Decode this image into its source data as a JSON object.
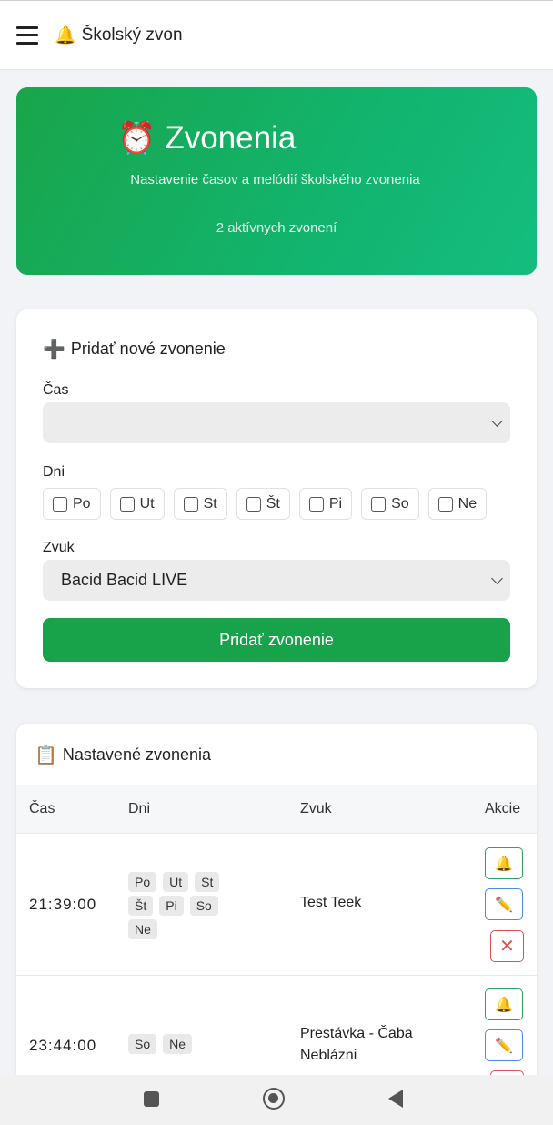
{
  "app": {
    "title": "Školský zvon",
    "bell_icon": "🔔"
  },
  "hero": {
    "icon": "⏰",
    "title": "Zvonenia",
    "subtitle": "Nastavenie časov a melódií školského zvonenia",
    "active_count": "2 aktívnych zvonení"
  },
  "form": {
    "icon": "➕",
    "title": "Pridať nové zvonenie",
    "time_label": "Čas",
    "time_value": "",
    "days_label": "Dni",
    "days": [
      "Po",
      "Ut",
      "St",
      "Št",
      "Pi",
      "So",
      "Ne"
    ],
    "sound_label": "Zvuk",
    "sound_value": "Bacid Bacid LIVE",
    "submit_label": "Pridať zvonenie",
    "accent_color": "#18a34b"
  },
  "list": {
    "icon": "📋",
    "title": "Nastavené zvonenia",
    "columns": {
      "time": "Čas",
      "days": "Dni",
      "sound": "Zvuk",
      "actions": "Akcie"
    },
    "rows": [
      {
        "time": "21:39:00",
        "days": [
          "Po",
          "Ut",
          "St",
          "Št",
          "Pi",
          "So",
          "Ne"
        ],
        "sound": "Test Teek"
      },
      {
        "time": "23:44:00",
        "days": [
          "So",
          "Ne"
        ],
        "sound": "Prestávka - Čaba Neblázni"
      }
    ],
    "actions": {
      "ring_icon": "🔔",
      "edit_icon": "✏️",
      "delete_icon": "✕"
    }
  }
}
